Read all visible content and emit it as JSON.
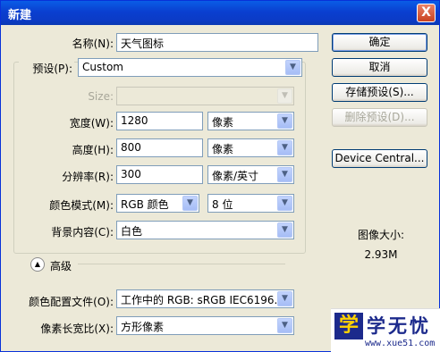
{
  "window": {
    "title": "新建",
    "close": "X"
  },
  "name": {
    "label": "名称(N):",
    "value": "天气图标"
  },
  "preset": {
    "label": "预设(P):",
    "value": "Custom"
  },
  "size": {
    "label": "Size:",
    "value": ""
  },
  "width": {
    "label": "宽度(W):",
    "value": "1280",
    "unit": "像素"
  },
  "height": {
    "label": "高度(H):",
    "value": "800",
    "unit": "像素"
  },
  "resolution": {
    "label": "分辨率(R):",
    "value": "300",
    "unit": "像素/英寸"
  },
  "color_mode": {
    "label": "颜色模式(M):",
    "value": "RGB 颜色",
    "bits": "8 位"
  },
  "background": {
    "label": "背景内容(C):",
    "value": "白色"
  },
  "advanced": {
    "label": "高级"
  },
  "color_profile": {
    "label": "颜色配置文件(O):",
    "value": "工作中的 RGB: sRGB IEC6196..."
  },
  "pixel_aspect": {
    "label": "像素长宽比(X):",
    "value": "方形像素"
  },
  "buttons": {
    "ok": "确定",
    "cancel": "取消",
    "save_preset": "存储预设(S)...",
    "delete_preset": "删除预设(D)...",
    "device_central": "Device Central..."
  },
  "image_size": {
    "label": "图像大小:",
    "value": "2.93M"
  },
  "watermark": {
    "logo": "学",
    "text": "学无忧",
    "url": "www.xue51.com"
  }
}
